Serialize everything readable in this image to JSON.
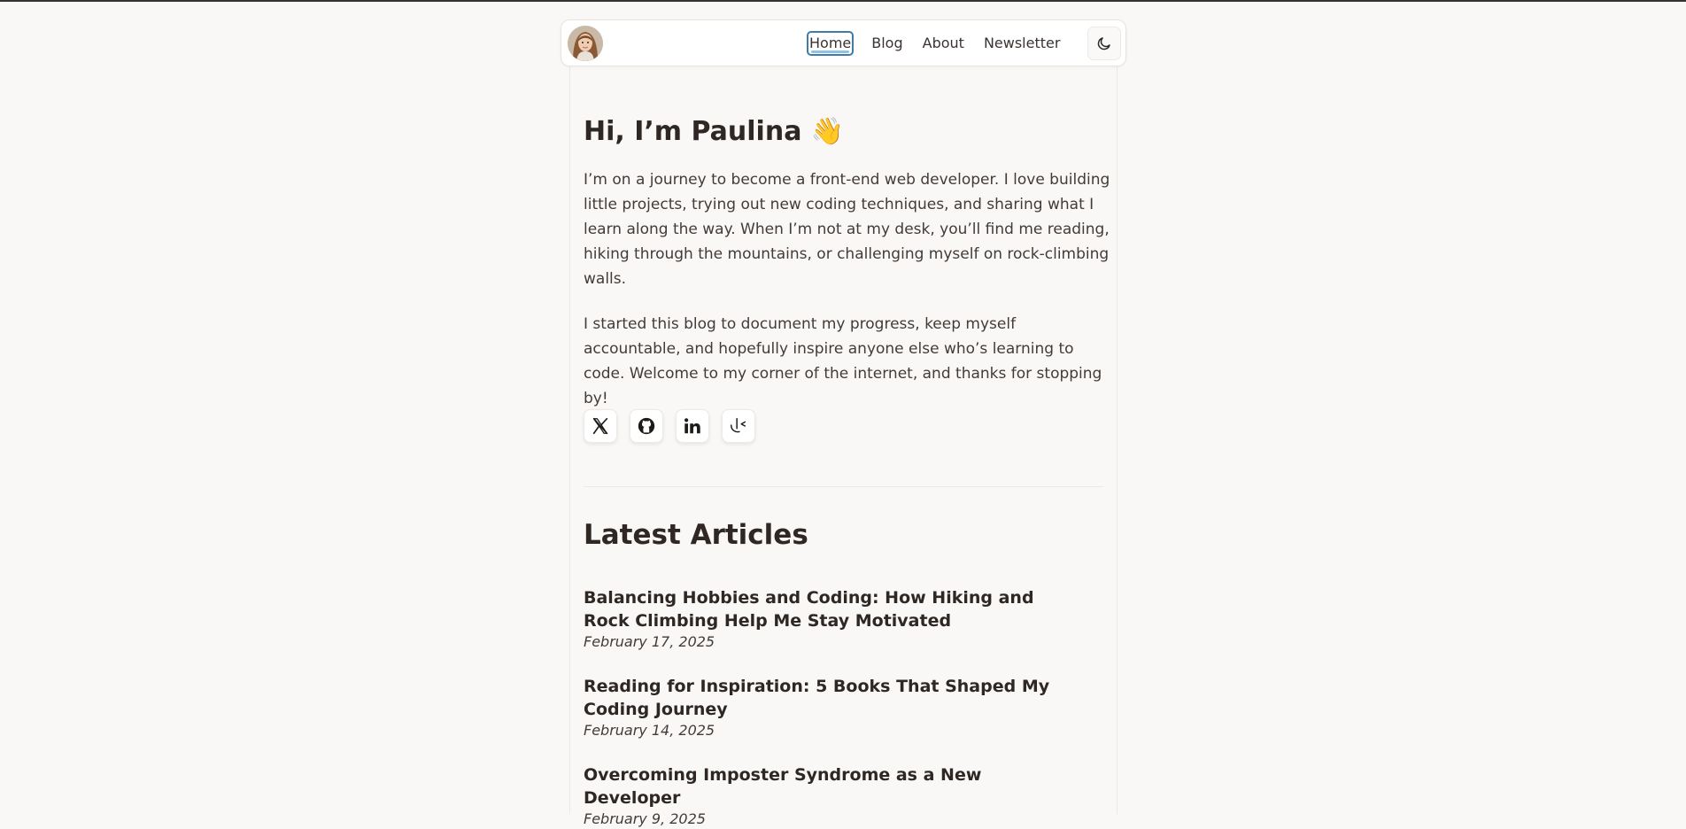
{
  "nav": {
    "avatar_alt": "Paulina avatar",
    "links": [
      {
        "label": "Home",
        "active": true
      },
      {
        "label": "Blog",
        "active": false
      },
      {
        "label": "About",
        "active": false
      },
      {
        "label": "Newsletter",
        "active": false
      }
    ],
    "theme_toggle_icon": "moon-icon"
  },
  "hero": {
    "title": "Hi, I’m Paulina",
    "emoji": "👋",
    "bio_1": "I’m on a journey to become a front-end web developer. I love building little projects, trying out new coding techniques, and sharing what I learn along the way. When I’m not at my desk, you’ll find me reading, hiking through the mountains, or challenging myself on rock-climbing walls.",
    "bio_2": "I started this blog to document my progress, keep myself accountable, and hopefully inspire anyone else who’s learning to code. Welcome to my corner of the internet, and thanks for stopping by!"
  },
  "socials": [
    "x-icon",
    "github-icon",
    "linkedin-icon",
    "frontend-mentor-icon"
  ],
  "latest": {
    "title": "Latest Articles",
    "articles": [
      {
        "title": "Balancing Hobbies and Coding: How Hiking and Rock Climbing Help Me Stay Motivated",
        "date": "February 17, 2025"
      },
      {
        "title": "Reading for Inspiration: 5 Books That Shaped My Coding Journey",
        "date": "February 14, 2025"
      },
      {
        "title": "Overcoming Imposter Syndrome as a New Developer",
        "date": "February 9, 2025"
      }
    ]
  },
  "colors": {
    "accent": "#8fc3e6",
    "focus_ring": "#3d7ca8",
    "background": "#faf8f6",
    "text": "#2e2724"
  }
}
